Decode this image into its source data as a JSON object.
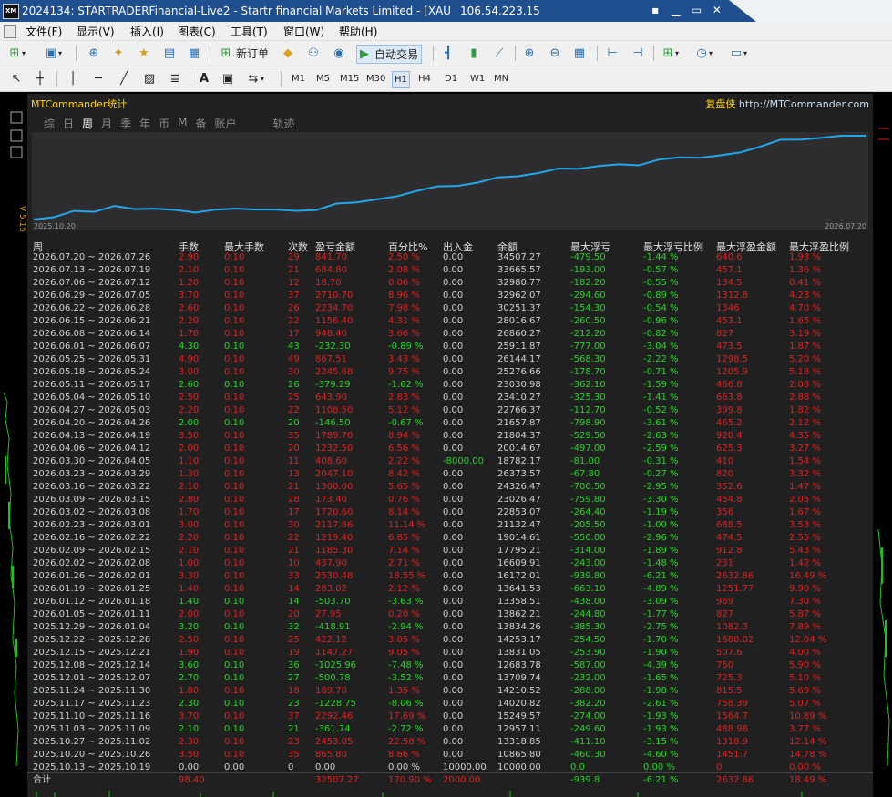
{
  "titlebar": {
    "app_icon": "XM",
    "title": "2024134: STARTRADERFinancial-Live2 - Startr  financial Markets Limited - [XAU",
    "server_ip": "106.54.223.15",
    "buttons": {
      "a": "▪",
      "b": "▁",
      "c": "▭",
      "d": "✕"
    }
  },
  "menu": {
    "file": "文件(F)",
    "view": "显示(V)",
    "insert": "插入(I)",
    "charts": "图表(C)",
    "tools": "工具(T)",
    "window": "窗口(W)",
    "help": "帮助(H)"
  },
  "toolbar": {
    "new_order": "新订单",
    "auto_trade": "自动交易"
  },
  "timeframes": [
    "M1",
    "M5",
    "M15",
    "M30",
    "H1",
    "H4",
    "D1",
    "W1",
    "MN"
  ],
  "active_timeframe": "H1",
  "panel": {
    "title": "MTCommander统计",
    "brand_cn": "复盘侠",
    "brand_url": "http://MTCommander.com",
    "tabs": [
      "综",
      "日",
      "周",
      "月",
      "季",
      "年",
      "币",
      "M",
      "备",
      "账户",
      "轨迹"
    ],
    "active_tab": "周",
    "chart_start": "2025.10.20",
    "chart_end": "2026.07.20",
    "version": "V 5.15"
  },
  "table": {
    "headers": [
      "周",
      "手数",
      "最大手数",
      "次数",
      "盈亏金额",
      "百分比%",
      "出入金",
      "余额",
      "最大浮亏",
      "最大浮亏比例",
      "最大浮盈金额",
      "最大浮盈比例"
    ],
    "rows": [
      [
        "2026.07.20 ~ 2026.07.26",
        "2.90",
        "0.10",
        "29",
        "841.70",
        "2.50 %",
        "0.00",
        "34507.27",
        "-479.50",
        "-1.44 %",
        "640.6",
        "1.93 %"
      ],
      [
        "2026.07.13 ~ 2026.07.19",
        "2.10",
        "0.10",
        "21",
        "684.80",
        "2.08 %",
        "0.00",
        "33665.57",
        "-193.00",
        "-0.57 %",
        "457.1",
        "1.36 %"
      ],
      [
        "2026.07.06 ~ 2026.07.12",
        "1.20",
        "0.10",
        "12",
        "18.70",
        "0.06 %",
        "0.00",
        "32980.77",
        "-182.20",
        "-0.55 %",
        "134.5",
        "0.41 %"
      ],
      [
        "2026.06.29 ~ 2026.07.05",
        "3.70",
        "0.10",
        "37",
        "2710.70",
        "8.96 %",
        "0.00",
        "32962.07",
        "-294.60",
        "-0.89 %",
        "1312.8",
        "4.23 %"
      ],
      [
        "2026.06.22 ~ 2026.06.28",
        "2.60",
        "0.10",
        "26",
        "2234.70",
        "7.98 %",
        "0.00",
        "30251.37",
        "-154.30",
        "-0.54 %",
        "1346",
        "4.70 %"
      ],
      [
        "2026.06.15 ~ 2026.06.21",
        "2.20",
        "0.10",
        "22",
        "1156.40",
        "4.31 %",
        "0.00",
        "28016.67",
        "-260.50",
        "-0.96 %",
        "453.1",
        "1.65 %"
      ],
      [
        "2026.06.08 ~ 2026.06.14",
        "1.70",
        "0.10",
        "17",
        "948.40",
        "3.66 %",
        "0.00",
        "26860.27",
        "-212.20",
        "-0.82 %",
        "827",
        "3.19 %"
      ],
      [
        "2026.06.01 ~ 2026.06.07",
        "4.30",
        "0.10",
        "43",
        "-232.30",
        "-0.89 %",
        "0.00",
        "25911.87",
        "-777.00",
        "-3.04 %",
        "473.5",
        "1.87 %"
      ],
      [
        "2026.05.25 ~ 2026.05.31",
        "4.90",
        "0.10",
        "49",
        "867.51",
        "3.43 %",
        "0.00",
        "26144.17",
        "-568.30",
        "-2.22 %",
        "1298.5",
        "5.20 %"
      ],
      [
        "2026.05.18 ~ 2026.05.24",
        "3.00",
        "0.10",
        "30",
        "2245.68",
        "9.75 %",
        "0.00",
        "25276.66",
        "-178.70",
        "-0.71 %",
        "1205.9",
        "5.18 %"
      ],
      [
        "2026.05.11 ~ 2026.05.17",
        "2.60",
        "0.10",
        "26",
        "-379.29",
        "-1.62 %",
        "0.00",
        "23030.98",
        "-362.10",
        "-1.59 %",
        "466.8",
        "2.08 %"
      ],
      [
        "2026.05.04 ~ 2026.05.10",
        "2.50",
        "0.10",
        "25",
        "643.90",
        "2.83 %",
        "0.00",
        "23410.27",
        "-325.30",
        "-1.41 %",
        "663.8",
        "2.88 %"
      ],
      [
        "2026.04.27 ~ 2026.05.03",
        "2.20",
        "0.10",
        "22",
        "1108.50",
        "5.12 %",
        "0.00",
        "22766.37",
        "-112.70",
        "-0.52 %",
        "399.8",
        "1.82 %"
      ],
      [
        "2026.04.20 ~ 2026.04.26",
        "2.00",
        "0.10",
        "20",
        "-146.50",
        "-0.67 %",
        "0.00",
        "21657.87",
        "-798.90",
        "-3.61 %",
        "465.2",
        "2.12 %"
      ],
      [
        "2026.04.13 ~ 2026.04.19",
        "3.50",
        "0.10",
        "35",
        "1789.70",
        "8.94 %",
        "0.00",
        "21804.37",
        "-529.50",
        "-2.63 %",
        "920.4",
        "4.35 %"
      ],
      [
        "2026.04.06 ~ 2026.04.12",
        "2.00",
        "0.10",
        "20",
        "1232.50",
        "6.56 %",
        "0.00",
        "20014.67",
        "-497.00",
        "-2.59 %",
        "625.3",
        "3.27 %"
      ],
      [
        "2026.03.30 ~ 2026.04.05",
        "1.10",
        "0.10",
        "11",
        "408.60",
        "2.22 %",
        "-8000.00",
        "18782.17",
        "-81.00",
        "-0.31 %",
        "410",
        "1.54 %"
      ],
      [
        "2026.03.23 ~ 2026.03.29",
        "1.30",
        "0.10",
        "13",
        "2047.10",
        "8.42 %",
        "0.00",
        "26373.57",
        "-67.80",
        "-0.27 %",
        "820",
        "3.32 %"
      ],
      [
        "2026.03.16 ~ 2026.03.22",
        "2.10",
        "0.10",
        "21",
        "1300.00",
        "5.65 %",
        "0.00",
        "24326.47",
        "-700.50",
        "-2.95 %",
        "352.6",
        "1.47 %"
      ],
      [
        "2026.03.09 ~ 2026.03.15",
        "2.80",
        "0.10",
        "28",
        "173.40",
        "0.76 %",
        "0.00",
        "23026.47",
        "-759.80",
        "-3.30 %",
        "454.8",
        "2.05 %"
      ],
      [
        "2026.03.02 ~ 2026.03.08",
        "1.70",
        "0.10",
        "17",
        "1720.60",
        "8.14 %",
        "0.00",
        "22853.07",
        "-264.40",
        "-1.19 %",
        "356",
        "1.67 %"
      ],
      [
        "2026.02.23 ~ 2026.03.01",
        "3.00",
        "0.10",
        "30",
        "2117.86",
        "11.14 %",
        "0.00",
        "21132.47",
        "-205.50",
        "-1.00 %",
        "688.5",
        "3.53 %"
      ],
      [
        "2026.02.16 ~ 2026.02.22",
        "2.20",
        "0.10",
        "22",
        "1219.40",
        "6.85 %",
        "0.00",
        "19014.61",
        "-550.00",
        "-2.96 %",
        "474.5",
        "2.55 %"
      ],
      [
        "2026.02.09 ~ 2026.02.15",
        "2.10",
        "0.10",
        "21",
        "1185.30",
        "7.14 %",
        "0.00",
        "17795.21",
        "-314.00",
        "-1.89 %",
        "912.8",
        "5.43 %"
      ],
      [
        "2026.02.02 ~ 2026.02.08",
        "1.00",
        "0.10",
        "10",
        "437.90",
        "2.71 %",
        "0.00",
        "16609.91",
        "-243.00",
        "-1.48 %",
        "231",
        "1.42 %"
      ],
      [
        "2026.01.26 ~ 2026.02.01",
        "3.30",
        "0.10",
        "33",
        "2530.48",
        "18.55 %",
        "0.00",
        "16172.01",
        "-939.80",
        "-6.21 %",
        "2632.86",
        "16.49 %"
      ],
      [
        "2026.01.19 ~ 2026.01.25",
        "1.40",
        "0.10",
        "14",
        "283.02",
        "2.12 %",
        "0.00",
        "13641.53",
        "-663.10",
        "-4.89 %",
        "1251.77",
        "9.90 %"
      ],
      [
        "2026.01.12 ~ 2026.01.18",
        "1.40",
        "0.10",
        "14",
        "-503.70",
        "-3.63 %",
        "0.00",
        "13358.51",
        "-438.00",
        "-3.09 %",
        "989",
        "7.30 %"
      ],
      [
        "2026.01.05 ~ 2026.01.11",
        "2.00",
        "0.10",
        "20",
        "27.95",
        "0.20 %",
        "0.00",
        "13862.21",
        "-244.80",
        "-1.77 %",
        "827",
        "5.87 %"
      ],
      [
        "2025.12.29 ~ 2026.01.04",
        "3.20",
        "0.10",
        "32",
        "-418.91",
        "-2.94 %",
        "0.00",
        "13834.26",
        "-385.30",
        "-2.75 %",
        "1082.3",
        "7.89 %"
      ],
      [
        "2025.12.22 ~ 2025.12.28",
        "2.50",
        "0.10",
        "25",
        "422.12",
        "3.05 %",
        "0.00",
        "14253.17",
        "-254.50",
        "-1.70 %",
        "1680.02",
        "12.04 %"
      ],
      [
        "2025.12.15 ~ 2025.12.21",
        "1.90",
        "0.10",
        "19",
        "1147.27",
        "9.05 %",
        "0.00",
        "13831.05",
        "-253.90",
        "-1.90 %",
        "507.6",
        "4.00 %"
      ],
      [
        "2025.12.08 ~ 2025.12.14",
        "3.60",
        "0.10",
        "36",
        "-1025.96",
        "-7.48 %",
        "0.00",
        "12683.78",
        "-587.00",
        "-4.39 %",
        "760",
        "5.90 %"
      ],
      [
        "2025.12.01 ~ 2025.12.07",
        "2.70",
        "0.10",
        "27",
        "-500.78",
        "-3.52 %",
        "0.00",
        "13709.74",
        "-232.00",
        "-1.65 %",
        "725.3",
        "5.10 %"
      ],
      [
        "2025.11.24 ~ 2025.11.30",
        "1.80",
        "0.10",
        "18",
        "189.70",
        "1.35 %",
        "0.00",
        "14210.52",
        "-288.00",
        "-1.98 %",
        "815.5",
        "5.69 %"
      ],
      [
        "2025.11.17 ~ 2025.11.23",
        "2.30",
        "0.10",
        "23",
        "-1228.75",
        "-8.06 %",
        "0.00",
        "14020.82",
        "-382.20",
        "-2.61 %",
        "758.39",
        "5.07 %"
      ],
      [
        "2025.11.10 ~ 2025.11.16",
        "3.70",
        "0.10",
        "37",
        "2292.46",
        "17.69 %",
        "0.00",
        "15249.57",
        "-274.00",
        "-1.93 %",
        "1564.7",
        "10.89 %"
      ],
      [
        "2025.11.03 ~ 2025.11.09",
        "2.10",
        "0.10",
        "21",
        "-361.74",
        "-2.72 %",
        "0.00",
        "12957.11",
        "-249.60",
        "-1.93 %",
        "488.96",
        "3.77 %"
      ],
      [
        "2025.10.27 ~ 2025.11.02",
        "2.30",
        "0.10",
        "23",
        "2453.05",
        "22.58 %",
        "0.00",
        "13318.85",
        "-411.10",
        "-3.15 %",
        "1318.9",
        "12.14 %"
      ],
      [
        "2025.10.20 ~ 2025.10.26",
        "3.50",
        "0.10",
        "35",
        "865.80",
        "8.66 %",
        "0.00",
        "10865.80",
        "-460.30",
        "-4.60 %",
        "1451.7",
        "14.78 %"
      ],
      [
        "2025.10.13 ~ 2025.10.19",
        "0.00",
        "0.00",
        "0",
        "0.00",
        "0.00 %",
        "10000.00",
        "10000.00",
        "0.0",
        "0.00 %",
        "0",
        "0.00 %"
      ]
    ],
    "total": [
      "合计",
      "98.40",
      "",
      "",
      "32507.27",
      "170.90 %",
      "2000.00",
      "",
      "-939.8",
      "-6.21 %",
      "2632.86",
      "18.49 %"
    ]
  },
  "chart_data": {
    "type": "line",
    "title": "",
    "x": [
      "2025.10.13",
      "2025.10.20",
      "2025.10.27",
      "2025.11.03",
      "2025.11.10",
      "2025.11.17",
      "2025.11.24",
      "2025.12.01",
      "2025.12.08",
      "2025.12.15",
      "2025.12.22",
      "2025.12.29",
      "2026.01.05",
      "2026.01.12",
      "2026.01.19",
      "2026.01.26",
      "2026.02.02",
      "2026.02.09",
      "2026.02.16",
      "2026.02.23",
      "2026.03.02",
      "2026.03.09",
      "2026.03.16",
      "2026.03.23",
      "2026.03.30",
      "2026.04.06",
      "2026.04.13",
      "2026.04.20",
      "2026.04.27",
      "2026.05.04",
      "2026.05.11",
      "2026.05.18",
      "2026.05.25",
      "2026.06.01",
      "2026.06.08",
      "2026.06.15",
      "2026.06.22",
      "2026.06.29",
      "2026.07.06",
      "2026.07.13",
      "2026.07.20"
    ],
    "series": [
      {
        "values": [
          10000.0,
          10865.8,
          13318.85,
          12957.11,
          15249.57,
          14020.82,
          14210.52,
          13709.74,
          12683.78,
          13831.05,
          14253.17,
          13834.26,
          13862.21,
          13358.51,
          13641.53,
          16172.01,
          16609.91,
          17795.21,
          19014.61,
          21132.47,
          22853.07,
          23026.47,
          24326.47,
          26373.57,
          26782.17,
          28014.67,
          29804.37,
          29657.87,
          30766.37,
          31410.27,
          31030.98,
          33276.66,
          34144.17,
          33911.87,
          34860.27,
          36016.67,
          38251.37,
          40962.07,
          40980.77,
          41665.57,
          42507.27
        ]
      }
    ],
    "xlabel": "",
    "ylabel": "",
    "colors": {
      "line": "#23a6e8",
      "background": "#2d2d30"
    }
  }
}
